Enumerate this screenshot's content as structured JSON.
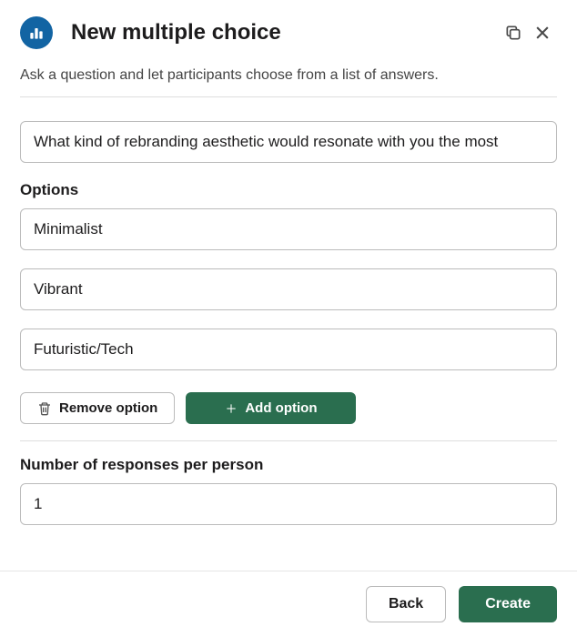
{
  "header": {
    "title": "New multiple choice"
  },
  "description": "Ask a question and let participants choose from a list of answers.",
  "question": {
    "value": "What kind of rebranding aesthetic would resonate with you the most"
  },
  "optionsLabel": "Options",
  "options": [
    {
      "value": "Minimalist"
    },
    {
      "value": "Vibrant"
    },
    {
      "value": "Futuristic/Tech"
    }
  ],
  "buttons": {
    "remove": "Remove option",
    "add": "Add option",
    "back": "Back",
    "create": "Create"
  },
  "responsesLabel": "Number of responses per person",
  "responsesValue": "1"
}
